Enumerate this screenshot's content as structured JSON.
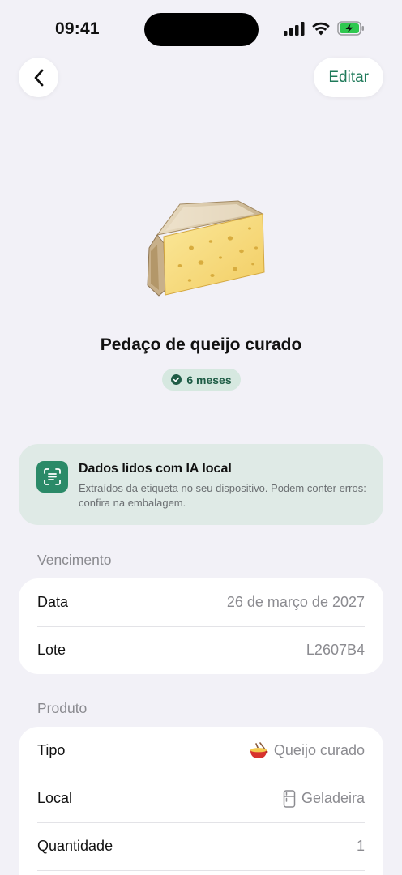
{
  "status_bar": {
    "time": "09:41"
  },
  "nav": {
    "back_icon": "chevron-left-icon",
    "edit_label": "Editar"
  },
  "product": {
    "title": "Pedaço de queijo curado",
    "badge_label": "6 meses",
    "badge_icon": "check-circle-icon"
  },
  "ai_card": {
    "title": "Dados lidos com IA local",
    "description": "Extraídos da etiqueta no seu dispositivo. Podem conter erros: confira na embalagem.",
    "icon": "scan-text-icon"
  },
  "expiry_section": {
    "header": "Vencimento",
    "rows": [
      {
        "label": "Data",
        "value": "26 de março de 2027"
      },
      {
        "label": "Lote",
        "value": "L2607B4"
      }
    ]
  },
  "product_section": {
    "header": "Produto",
    "rows": [
      {
        "label": "Tipo",
        "value": "Queijo curado",
        "icon": "fondue-emoji-icon"
      },
      {
        "label": "Local",
        "value": "Geladeira",
        "icon": "fridge-icon"
      },
      {
        "label": "Quantidade",
        "value": "1"
      }
    ]
  },
  "colors": {
    "accent": "#1f7a5a",
    "background": "#f2f1f7",
    "card": "#ffffff",
    "ai_card": "#dfeae6"
  }
}
